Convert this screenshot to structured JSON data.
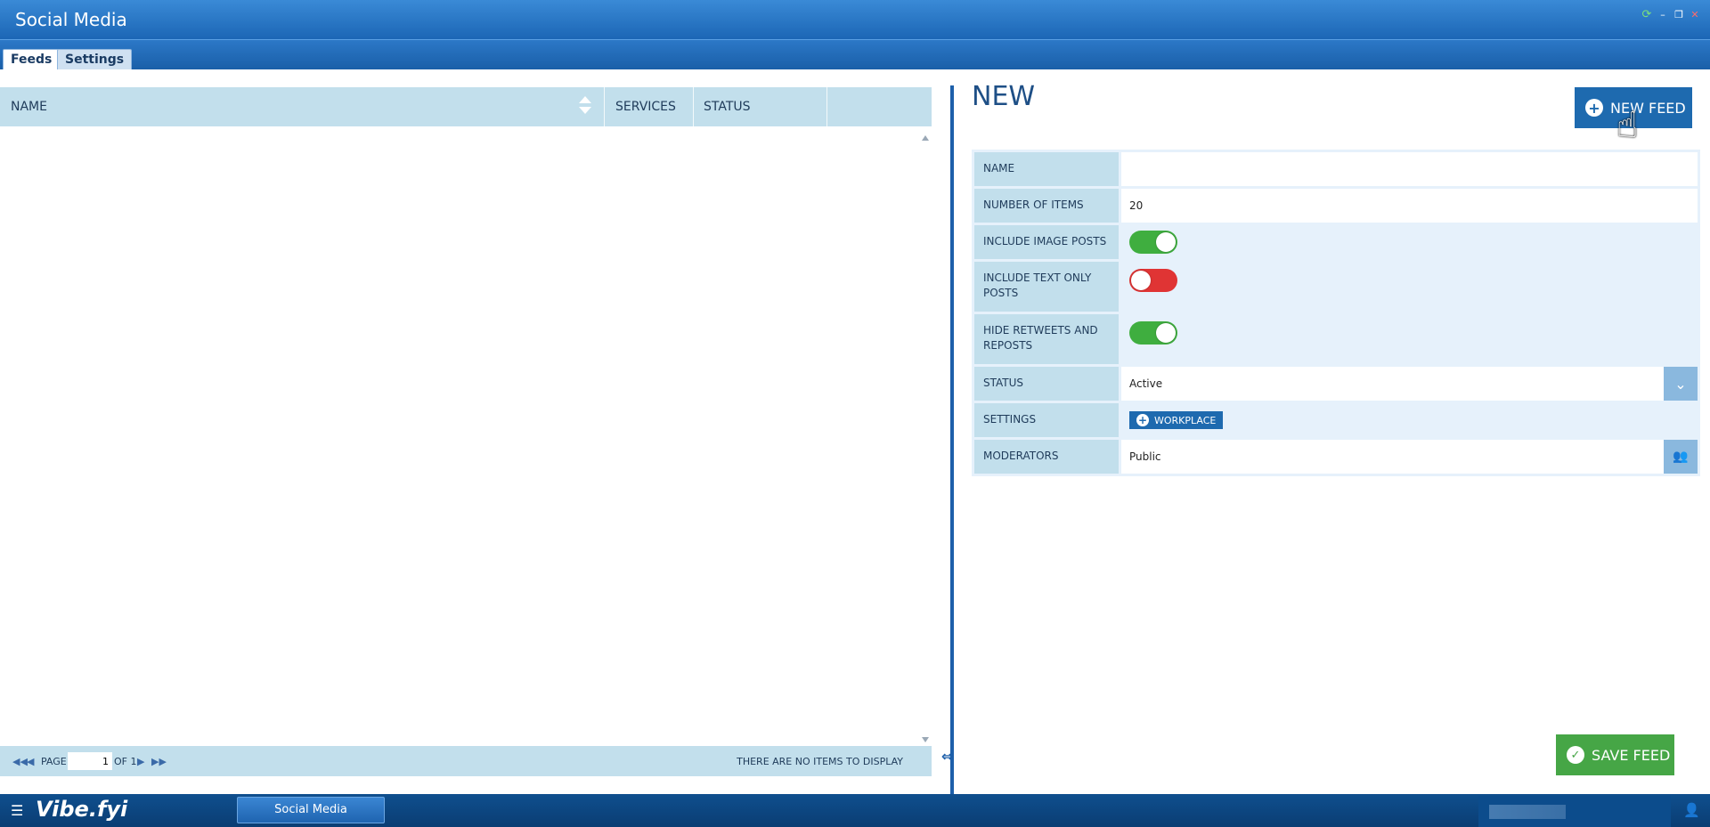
{
  "window": {
    "title": "Social Media"
  },
  "tabs": [
    {
      "label": "Feeds",
      "active": true
    },
    {
      "label": "Settings",
      "active": false
    }
  ],
  "grid": {
    "columns": [
      "NAME",
      "SERVICES",
      "STATUS"
    ],
    "rows": [],
    "pager": {
      "page_label": "PAGE",
      "page_value": "1",
      "of_label": "OF 1",
      "empty_message": "THERE ARE NO ITEMS TO DISPLAY"
    }
  },
  "form": {
    "title": "NEW",
    "new_button": "NEW FEED",
    "save_button": "SAVE FEED",
    "fields": {
      "name": {
        "label": "NAME",
        "value": ""
      },
      "number_of_items": {
        "label": "NUMBER OF ITEMS",
        "value": "20"
      },
      "include_image_posts": {
        "label": "INCLUDE IMAGE POSTS",
        "value": true
      },
      "include_text_only_posts": {
        "label": "INCLUDE TEXT ONLY POSTS",
        "value": false
      },
      "hide_retweets": {
        "label": "HIDE RETWEETS AND REPOSTS",
        "value": true
      },
      "status": {
        "label": "STATUS",
        "value": "Active"
      },
      "settings": {
        "label": "SETTINGS",
        "button": "WORKPLACE"
      },
      "moderators": {
        "label": "MODERATORS",
        "value": "Public"
      }
    }
  },
  "taskbar": {
    "logo": "Vibe.fyi",
    "open_app": "Social Media"
  },
  "colors": {
    "titlebar": "#1c66b5",
    "accent": "#1e6aaf",
    "toggle_on": "#3fae3f",
    "toggle_off": "#e03434",
    "save": "#46a646",
    "header_bg": "#c2dfec"
  },
  "icons": [
    "refresh-icon",
    "minimize-icon",
    "restore-icon",
    "close-icon",
    "sort-icon",
    "first-page-icon",
    "prev-page-icon",
    "next-page-icon",
    "last-page-icon",
    "plus-circle-icon",
    "check-circle-icon",
    "chevron-down-icon",
    "users-icon",
    "hamburger-icon",
    "user-settings-icon",
    "hand-cursor-icon",
    "splitter-icon"
  ]
}
